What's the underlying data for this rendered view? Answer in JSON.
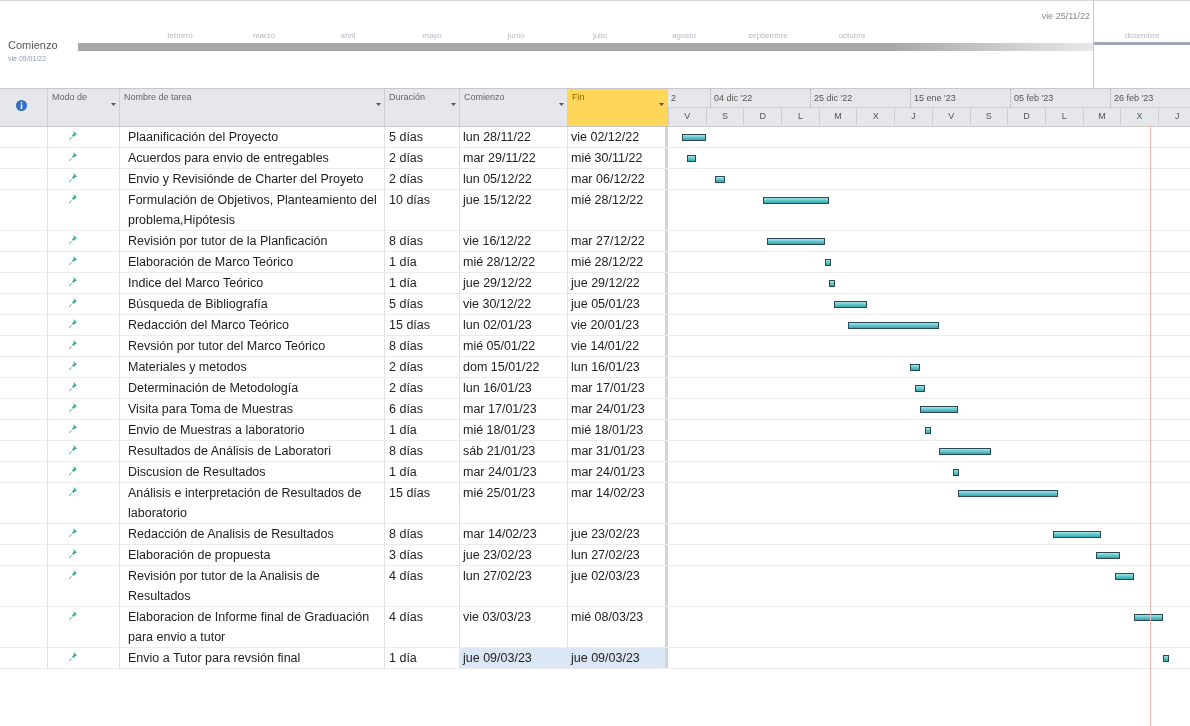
{
  "timeline": {
    "start_label": "Comienzo",
    "start_date": "vie 05/01/22",
    "months": [
      "febrero",
      "marzo",
      "abril",
      "mayo",
      "junio",
      "julio",
      "agosto",
      "septiembre",
      "octubre"
    ],
    "current_date": "vie 25/11/22",
    "next_month": "diciembre"
  },
  "columns": [
    {
      "kind": "info",
      "selected": false
    },
    {
      "kind": "text",
      "label": "Modo de",
      "selected": false
    },
    {
      "kind": "text",
      "label": "Nombre de tarea",
      "selected": false
    },
    {
      "kind": "text",
      "label": "Duración",
      "selected": false
    },
    {
      "kind": "text",
      "label": "Comienzo",
      "selected": false
    },
    {
      "kind": "text",
      "label": "Fin",
      "selected": true
    }
  ],
  "timescale": {
    "upper": [
      "2",
      "04 dic '22",
      "25 dic '22",
      "15 ene '23",
      "05 feb '23",
      "26 feb '23"
    ],
    "lower": [
      "V",
      "S",
      "D",
      "L",
      "M",
      "X",
      "J",
      "V",
      "S",
      "D",
      "L",
      "M",
      "X",
      "J"
    ]
  },
  "tasks": [
    {
      "name": "Plaanificación del Proyecto",
      "duration": "5 días",
      "start": "lun 28/11/22",
      "finish": "vie 02/12/22",
      "selected": false
    },
    {
      "name": "Acuerdos para envio de entregables",
      "duration": "2 días",
      "start": "mar 29/11/22",
      "finish": "mié 30/11/22",
      "selected": false
    },
    {
      "name": "Envio y Revisiónde de Charter del Proyeto",
      "duration": "2 días",
      "start": "lun 05/12/22",
      "finish": "mar 06/12/22",
      "selected": false
    },
    {
      "name": "Formulación de Objetivos, Planteamiento del problema,Hipótesis",
      "duration": "10 días",
      "start": "jue 15/12/22",
      "finish": "mié 28/12/22",
      "selected": false
    },
    {
      "name": "Revisión por tutor de la Planficación",
      "duration": "8 días",
      "start": "vie 16/12/22",
      "finish": "mar 27/12/22",
      "selected": false
    },
    {
      "name": "Elaboración de Marco Teórico",
      "duration": "1 día",
      "start": "mié 28/12/22",
      "finish": "mié 28/12/22",
      "selected": false
    },
    {
      "name": "Indice del Marco Teórico",
      "duration": "1 día",
      "start": "jue 29/12/22",
      "finish": "jue 29/12/22",
      "selected": false
    },
    {
      "name": "Búsqueda de Bibliografía",
      "duration": "5 días",
      "start": "vie 30/12/22",
      "finish": "jue 05/01/23",
      "selected": false
    },
    {
      "name": "Redacción del Marco Teórico",
      "duration": "15 días",
      "start": "lun 02/01/23",
      "finish": "vie 20/01/23",
      "selected": false
    },
    {
      "name": "Revsión por tutor del Marco Teórico",
      "duration": "8 días",
      "start": "mié 05/01/22",
      "finish": "vie 14/01/22",
      "selected": false
    },
    {
      "name": "Materiales y metodos",
      "duration": "2 días",
      "start": "dom 15/01/22",
      "finish": "lun 16/01/23",
      "selected": false
    },
    {
      "name": "Determinación de Metodología",
      "duration": "2 días",
      "start": "lun 16/01/23",
      "finish": "mar 17/01/23",
      "selected": false
    },
    {
      "name": "Visita para Toma de Muestras",
      "duration": "6 días",
      "start": "mar 17/01/23",
      "finish": "mar 24/01/23",
      "selected": false
    },
    {
      "name": "Envio de Muestras a laboratorio",
      "duration": "1 día",
      "start": "mié 18/01/23",
      "finish": "mié 18/01/23",
      "selected": false
    },
    {
      "name": "Resultados de Análisis de Laboratori",
      "duration": "8 días",
      "start": "sáb 21/01/23",
      "finish": "mar 31/01/23",
      "selected": false
    },
    {
      "name": "Discusion de Resultados",
      "duration": "1 día",
      "start": "mar 24/01/23",
      "finish": "mar 24/01/23",
      "selected": false
    },
    {
      "name": "Análisis e interpretación de Resultados de laboratorio",
      "duration": "15 días",
      "start": "mié 25/01/23",
      "finish": "mar 14/02/23",
      "selected": false
    },
    {
      "name": "Redacción de Analisis de Resultados",
      "duration": "8 días",
      "start": "mar 14/02/23",
      "finish": "jue 23/02/23",
      "selected": false
    },
    {
      "name": "Elaboración de propuesta",
      "duration": "3 días",
      "start": "jue 23/02/23",
      "finish": "lun 27/02/23",
      "selected": false
    },
    {
      "name": "Revisión por tutor de la Analisis de Resultados",
      "duration": "4 días",
      "start": "lun 27/02/23",
      "finish": "jue 02/03/23",
      "selected": false
    },
    {
      "name": "Elaboracion de Informe final de Graduación para envio a tutor",
      "duration": "4 días",
      "start": "vie 03/03/23",
      "finish": "mié 08/03/23",
      "selected": false
    },
    {
      "name": "Envio a Tutor para revsión final",
      "duration": "1 día",
      "start": "jue 09/03/23",
      "finish": "jue 09/03/23",
      "selected": true
    }
  ]
}
